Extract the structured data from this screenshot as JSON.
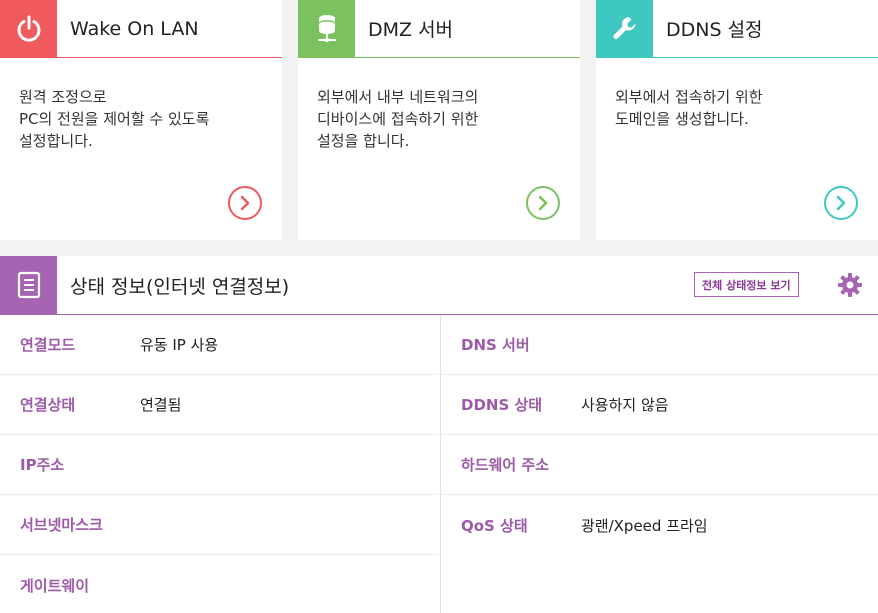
{
  "cards": [
    {
      "id": "wol",
      "icon": "power-icon",
      "title": "Wake On LAN",
      "description": "원격 조정으로\nPC의 전원을 제어할 수 있도록\n설정합니다.",
      "color": "#f05a5e"
    },
    {
      "id": "dmz",
      "icon": "database-server-icon",
      "title": "DMZ 서버",
      "description": "외부에서 내부 네트워크의\n디바이스에 접속하기 위한\n설정을 합니다.",
      "color": "#7cc160"
    },
    {
      "id": "ddns",
      "icon": "wrench-icon",
      "title": "DDNS 설정",
      "description": "외부에서 접속하기 위한\n도메인을 생성합니다.",
      "color": "#3ec8c1"
    }
  ],
  "status": {
    "icon": "document-list-icon",
    "title": "상태 정보(인터넷 연결정보)",
    "view_all_label": "전체 상태정보 보기",
    "settings_icon": "gear-icon",
    "color": "#a664b2",
    "left": [
      {
        "label": "연결모드",
        "value": "유동 IP 사용"
      },
      {
        "label": "연결상태",
        "value": "연결됨"
      },
      {
        "label": "IP주소",
        "value": ""
      },
      {
        "label": "서브넷마스크",
        "value": ""
      },
      {
        "label": "게이트웨이",
        "value": ""
      }
    ],
    "right": [
      {
        "label": "DNS 서버",
        "value": ""
      },
      {
        "label": "DDNS 상태",
        "value": "사용하지 않음"
      },
      {
        "label": "하드웨어 주소",
        "value": ""
      },
      {
        "label": "QoS 상태",
        "value": "광랜/Xpeed 프라임"
      }
    ]
  }
}
